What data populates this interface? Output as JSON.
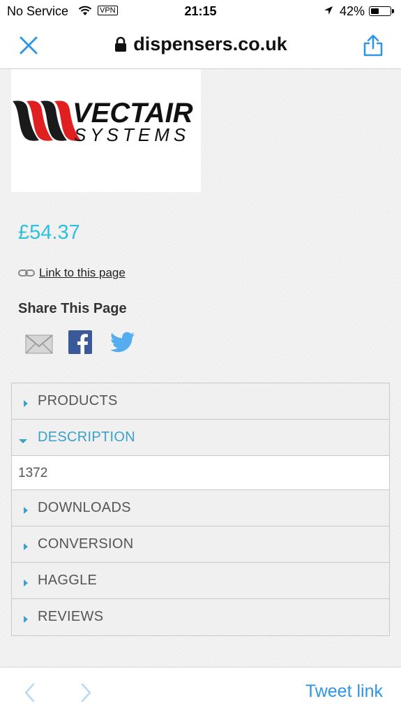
{
  "status_bar": {
    "carrier": "No Service",
    "vpn": "VPN",
    "time": "21:15",
    "battery": "42%",
    "battery_level": 0.42
  },
  "nav": {
    "url": "dispensers.co.uk"
  },
  "logo": {
    "line1": "VECTAIR",
    "line2": "SYSTEMS"
  },
  "product": {
    "price": "£54.37",
    "link_label": "Link to this page"
  },
  "share": {
    "title": "Share This Page",
    "icons": [
      "email-icon",
      "facebook-icon",
      "twitter-icon"
    ]
  },
  "accordion": {
    "items": [
      {
        "label": "PRODUCTS",
        "open": false
      },
      {
        "label": "DESCRIPTION",
        "open": true,
        "content": "1372"
      },
      {
        "label": "DOWNLOADS",
        "open": false
      },
      {
        "label": "CONVERSION",
        "open": false
      },
      {
        "label": "HAGGLE",
        "open": false
      },
      {
        "label": "REVIEWS",
        "open": false
      }
    ]
  },
  "bottom": {
    "tweet_label": "Tweet link"
  },
  "colors": {
    "accent": "#2cc0de",
    "link_blue": "#2f96e6",
    "accordion_open": "#3aa0cc",
    "facebook": "#3b5998",
    "twitter": "#55acee",
    "logo_red": "#e02020"
  }
}
